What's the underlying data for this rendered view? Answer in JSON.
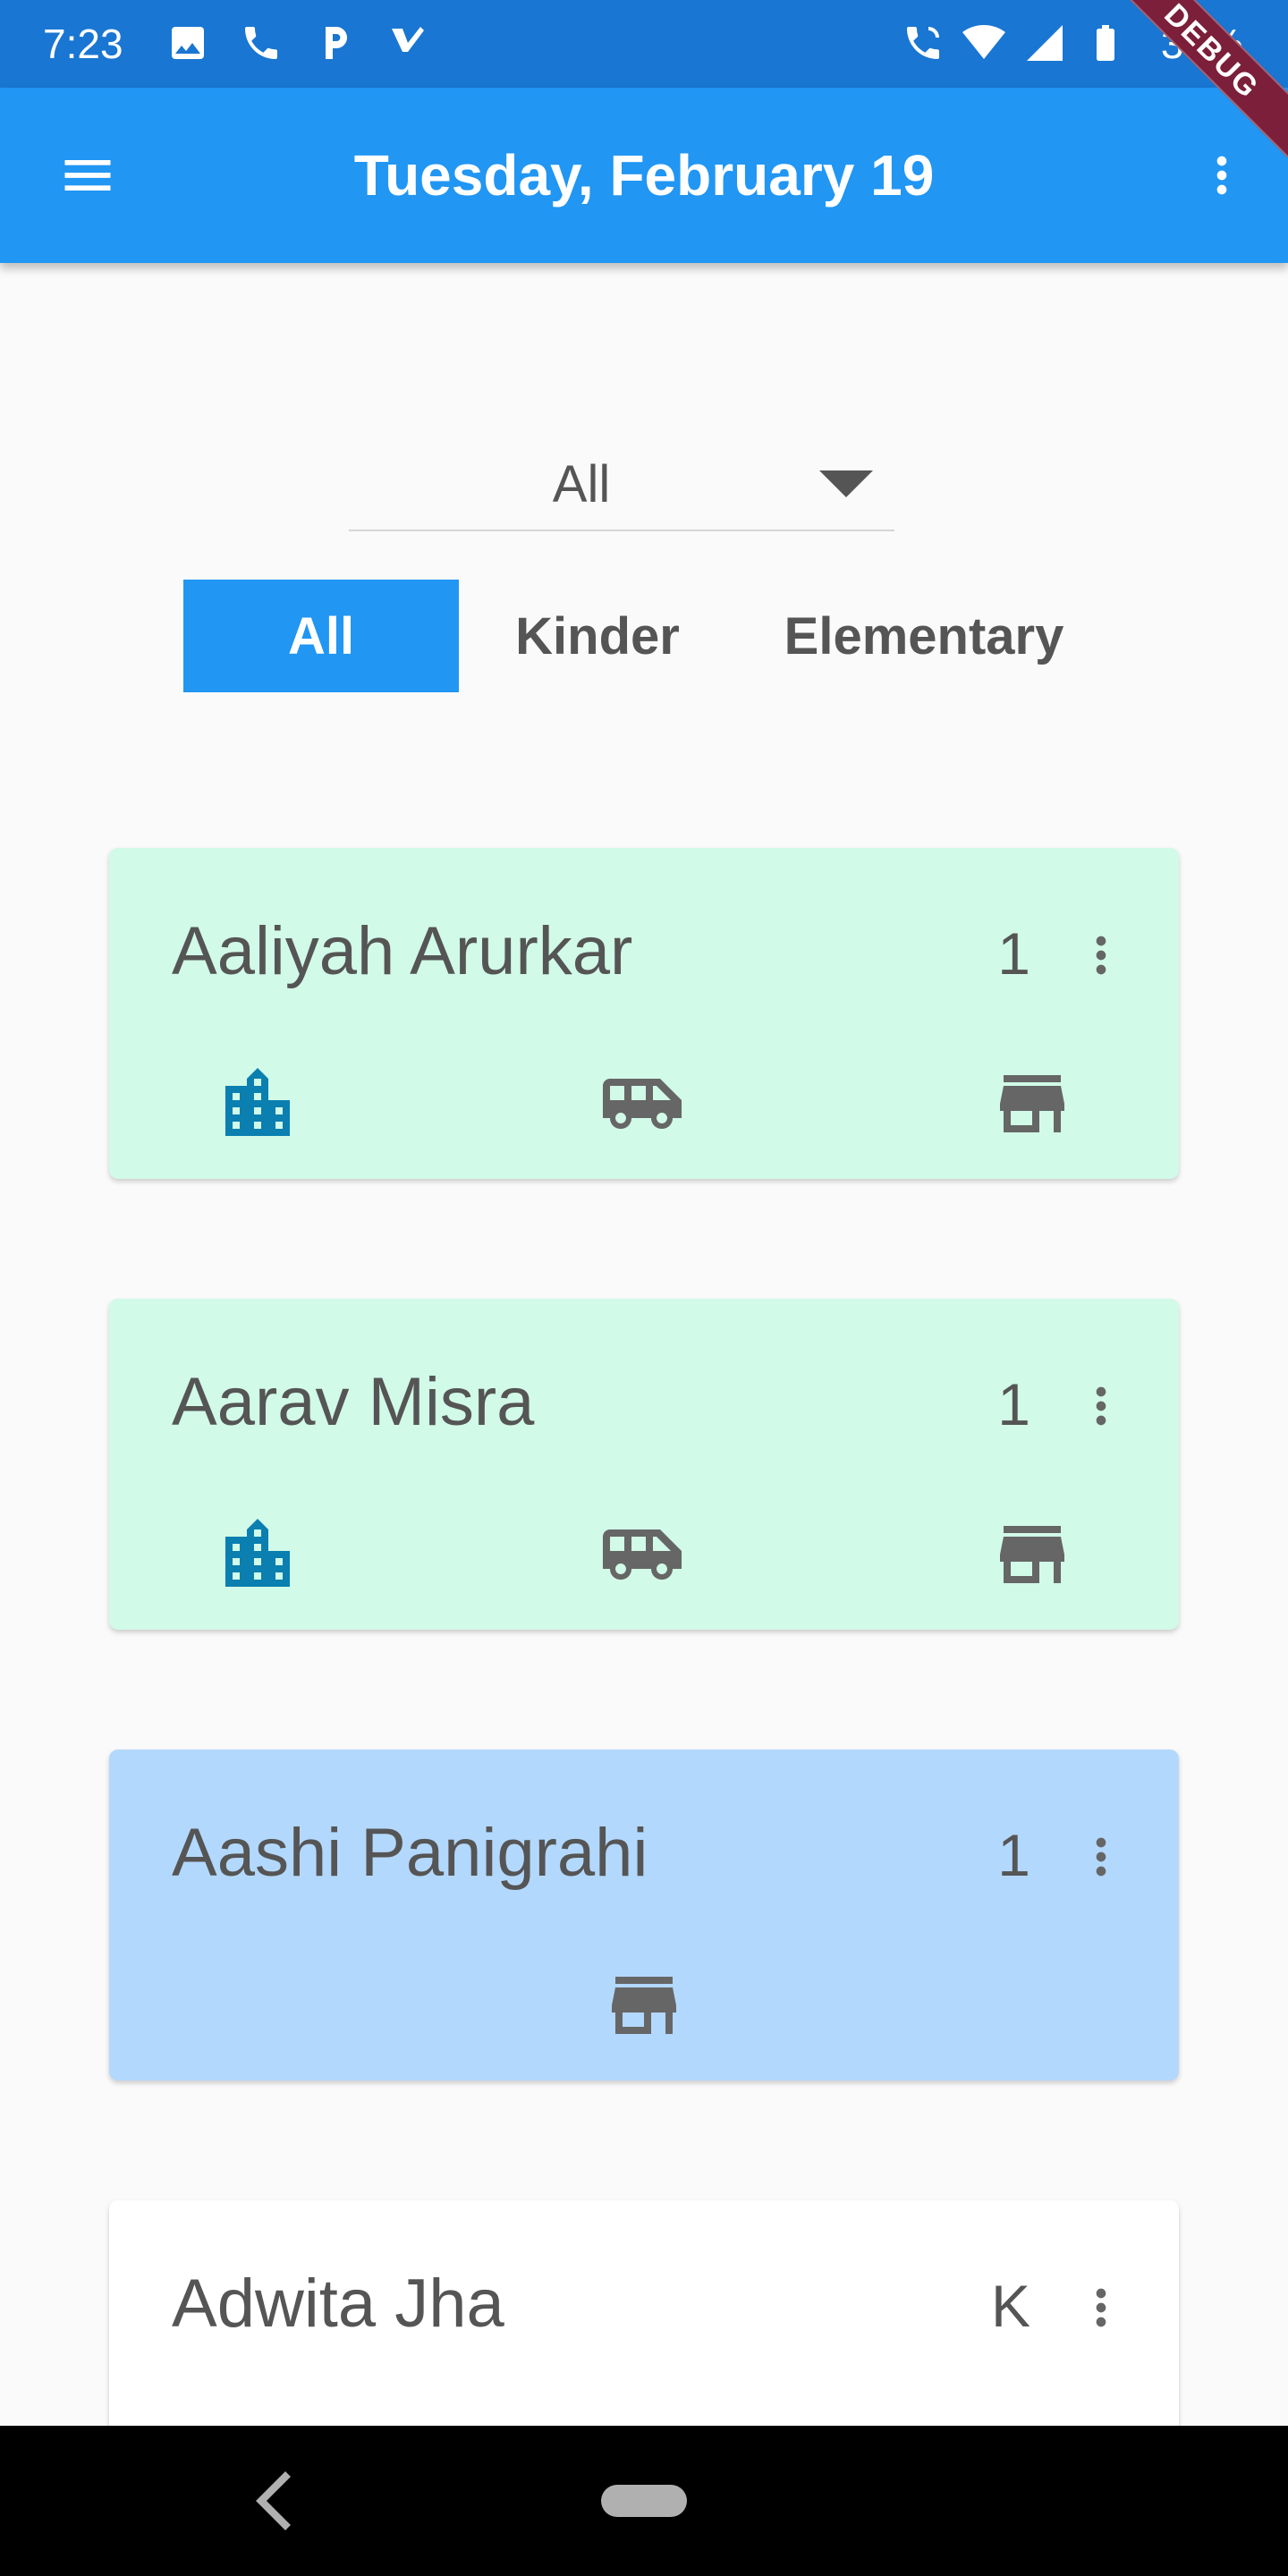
{
  "status_bar": {
    "time": "7:23",
    "battery": "35%",
    "debug_label": "DEBUG"
  },
  "app_bar": {
    "title": "Tuesday, February 19"
  },
  "filter": {
    "dropdown_value": "All",
    "tabs": [
      {
        "label": "All",
        "active": true
      },
      {
        "label": "Kinder",
        "active": false
      },
      {
        "label": "Elementary",
        "active": false
      }
    ]
  },
  "students": [
    {
      "name": "Aaliyah Arurkar",
      "grade": "1",
      "color": "#d1fae8",
      "icons": [
        "building-icon",
        "bus-icon",
        "store-icon"
      ]
    },
    {
      "name": "Aarav Misra",
      "grade": "1",
      "color": "#d1fae8",
      "icons": [
        "building-icon",
        "bus-icon",
        "store-icon"
      ]
    },
    {
      "name": "Aashi Panigrahi",
      "grade": "1",
      "color": "#b3d8fd",
      "icons": [
        "store-icon"
      ]
    },
    {
      "name": "Adwita Jha",
      "grade": "K",
      "color": "#ffffff",
      "icons": []
    }
  ],
  "colors": {
    "status_bar": "#1976d2",
    "app_bar": "#2196f3",
    "accent": "#2196f3",
    "building_icon": "#0a7fb0"
  }
}
